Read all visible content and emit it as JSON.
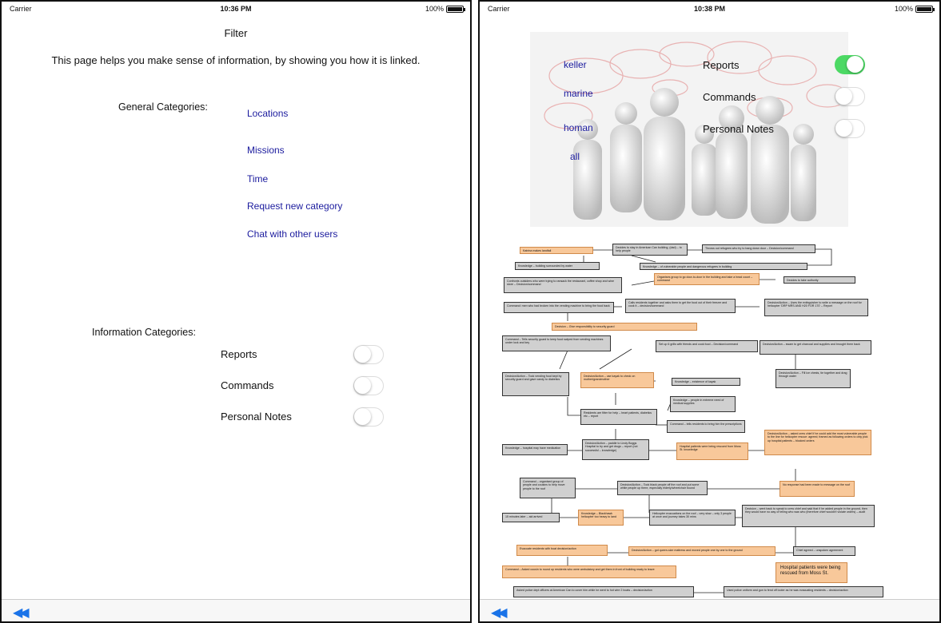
{
  "left": {
    "status": {
      "carrier": "Carrier",
      "time": "10:36 PM",
      "battery": "100%"
    },
    "title": "Filter",
    "intro": "This page helps you make sense of information, by showing you how it is linked.",
    "general_label": "General Categories:",
    "general_links": [
      "Locations",
      "Missions",
      "Time",
      "Request new category",
      "Chat with other users"
    ],
    "info_label": "Information Categories:",
    "toggles": [
      {
        "label": "Reports",
        "on": false
      },
      {
        "label": "Commands",
        "on": false
      },
      {
        "label": "Personal Notes",
        "on": false
      }
    ]
  },
  "right": {
    "status": {
      "carrier": "Carrier",
      "time": "10:38 PM",
      "battery": "100%"
    },
    "names": [
      "keller",
      "marine",
      "homan",
      "all"
    ],
    "toggles": [
      {
        "label": "Reports",
        "on": true
      },
      {
        "label": "Commands",
        "on": false
      },
      {
        "label": "Personal Notes",
        "on": false
      }
    ],
    "flow_nodes": [
      "Katrina makes landfall",
      "Decides to stay in American Can building, (dad) – to help people",
      "Throws out refugees who try to bang down door – Decision/command",
      "Knowledge – building surrounded by water",
      "Knowledge – of vulnerable people and dangerous refugees in building",
      "Organises group to go door-to-door in the building and take a head count – command",
      "Decides to take authority",
      "Confronts outsiders who were trying to ransack the restaurant, coffee shop and wine store – Decision/command",
      "Command: men who had broken into the vending machine to bring the food back",
      "Calls residents together and asks them to get the food out of their freezer and cook it – decision/command",
      "Decision/Action – Uses the extinguisher to write a message on the roof for helicopter 'DRP MRS AND H20 FOR 170' – Report",
      "Decision – Give responsibility to security guard",
      "Command – Tells security guard to keep food swiped from vending machines under lock and key",
      "Set up 6 grills with friends and cook food – Decision/command",
      "Decision/Action – swam to get charcoal and supplies and brought them back",
      "Decision/Action – Took vending food kept by security guard and gave candy to diabetics",
      "Decision/Action – use kayak to check on mother/grandmother",
      "Knowledge – existence of kayak",
      "Decision/Action – Fill ice chests, tie together and drag through water",
      "Knowledge – people in extreme need of medical supplies",
      "Residents are fitter for help – heart patients, diabetics etc – report",
      "Command – tells residents to bring him the prescriptions",
      "Knowledge – hospital may have medication",
      "Decision/Action – paddle to Lindy Boggs Hospital to try and get drugs – report (not successful – knowledge)",
      "Hospital patients were being rescued from Moss St. knowledge",
      "Decision/Action – asked crew chief if he could add the most vulnerable people to the line for helicopter rescue: agreed; framed as following orders to only pick up hospital patients – blocked orders",
      "Command – organised group of people and cousins to help move people to the roof",
      "Decision/Action – Took black people off the roof and put some white people up there, especially elderly/wheelchair bound",
      "No response had been made to message on the roof",
      "15 minutes later – aid arrived",
      "Knowledge – Blackhawk helicopter too heavy to land",
      "Helicopter evacuations on the roof – very slow – only 3 people at once and journey takes 30 mins",
      "Decision – went back to speak to crew chief and said that if he added people in the ground, then they would have no way of telling who was who (therefore chief wouldn't violate orders) – audit",
      "Evacuate residents with boat decision/action",
      "Decision/Action – got queen-size mattress and moved people one by one to the ground",
      "Chief agreed – unspoken agreement",
      "Command – Asked cousin to round up residents who were ambulatory and get them in front of building ready to leave",
      "Hospital patients were being rescued from Moss St.",
      "Asked police dept officers at American Can to cover him while he went to hot wire 2 boats – decision/action",
      "Used police uniform and gun to fend off looter as he was evacuating residents – decision/action"
    ]
  }
}
